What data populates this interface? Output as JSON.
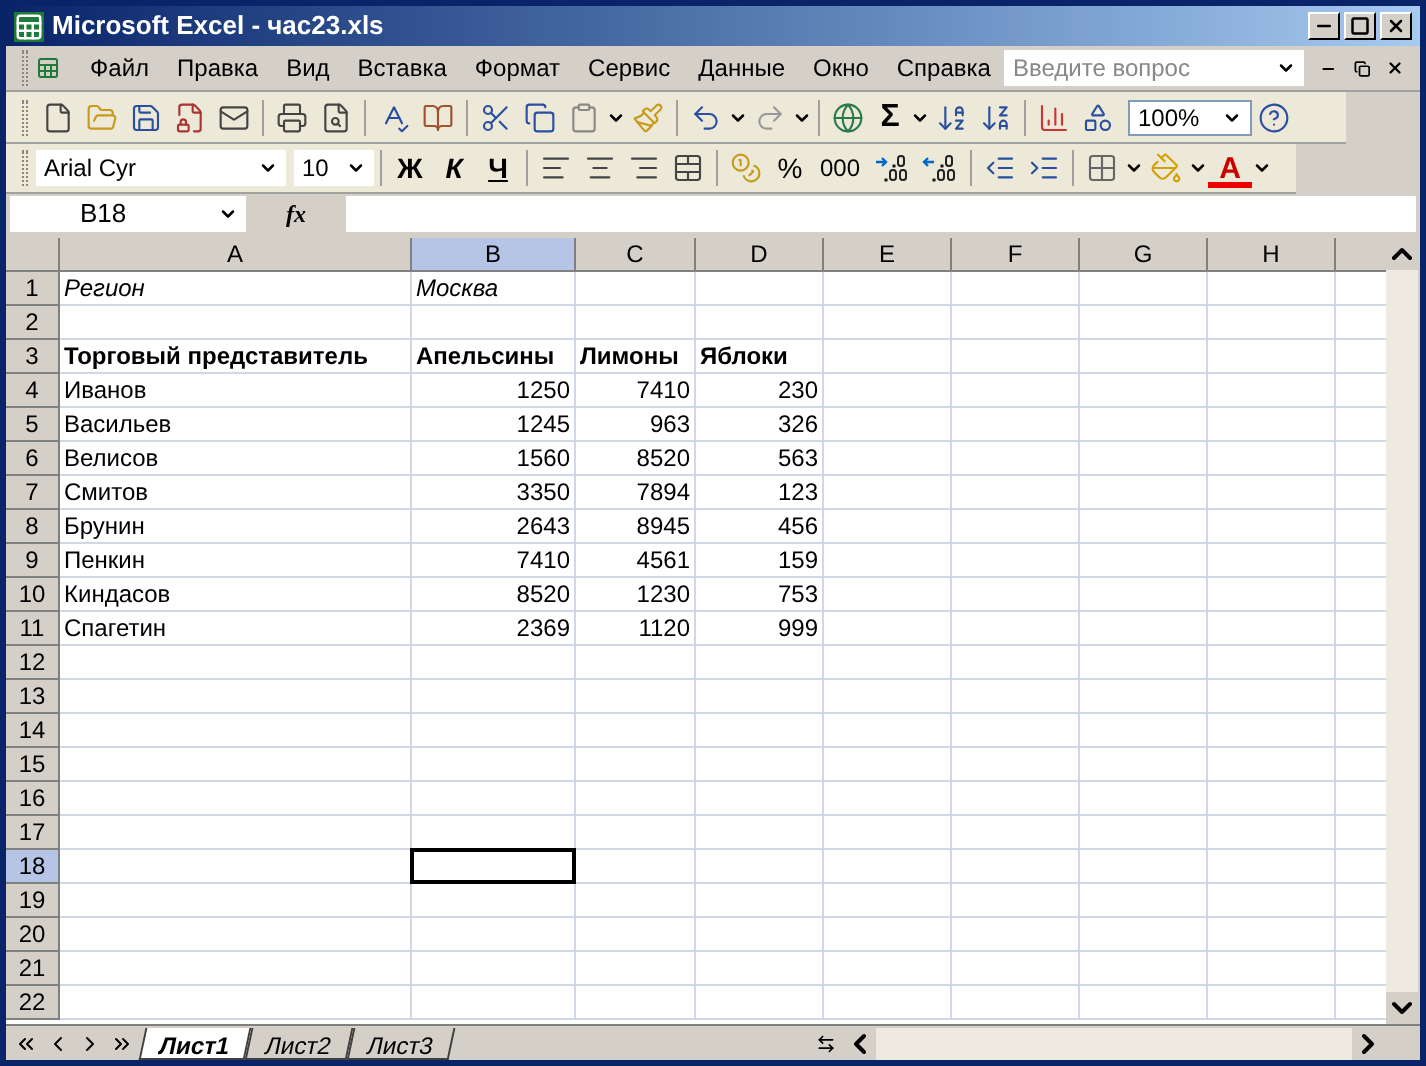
{
  "window": {
    "title": "Microsoft Excel - час23.xls"
  },
  "menu": [
    "Файл",
    "Правка",
    "Вид",
    "Вставка",
    "Формат",
    "Сервис",
    "Данные",
    "Окно",
    "Справка"
  ],
  "help_search": {
    "placeholder": "Введите вопрос"
  },
  "standard_toolbar": {
    "sum": "Σ",
    "zoom": "100%"
  },
  "format_toolbar": {
    "font": "Arial Cyr",
    "size": "10",
    "bold": "Ж",
    "italic": "К",
    "underline": "Ч",
    "percent": "%",
    "thousands": "000",
    "font_color": "A"
  },
  "formula_bar": {
    "name_box": "B18",
    "fx": "fx"
  },
  "columns": [
    {
      "label": "A",
      "selected": false
    },
    {
      "label": "B",
      "selected": true
    },
    {
      "label": "C",
      "selected": false
    },
    {
      "label": "D",
      "selected": false
    },
    {
      "label": "E",
      "selected": false
    },
    {
      "label": "F",
      "selected": false
    },
    {
      "label": "G",
      "selected": false
    },
    {
      "label": "H",
      "selected": false
    }
  ],
  "rows": [
    {
      "number": "1",
      "kind": "italic",
      "selected": false,
      "cells": [
        "Регион",
        "Москва"
      ]
    },
    {
      "number": "2",
      "kind": "empty",
      "selected": false,
      "cells": []
    },
    {
      "number": "3",
      "kind": "header",
      "selected": false,
      "cells": [
        "Торговый представитель",
        "Апельсины",
        "Лимоны",
        "Яблоки"
      ]
    },
    {
      "number": "4",
      "kind": "data",
      "selected": false,
      "cells": [
        "Иванов",
        "1250",
        "7410",
        "230"
      ]
    },
    {
      "number": "5",
      "kind": "data",
      "selected": false,
      "cells": [
        "Васильев",
        "1245",
        "963",
        "326"
      ]
    },
    {
      "number": "6",
      "kind": "data",
      "selected": false,
      "cells": [
        "Велисов",
        "1560",
        "8520",
        "563"
      ]
    },
    {
      "number": "7",
      "kind": "data",
      "selected": false,
      "cells": [
        "Смитов",
        "3350",
        "7894",
        "123"
      ]
    },
    {
      "number": "8",
      "kind": "data",
      "selected": false,
      "cells": [
        "Брунин",
        "2643",
        "8945",
        "456"
      ]
    },
    {
      "number": "9",
      "kind": "data",
      "selected": false,
      "cells": [
        "Пенкин",
        "7410",
        "4561",
        "159"
      ]
    },
    {
      "number": "10",
      "kind": "data",
      "selected": false,
      "cells": [
        "Киндасов",
        "8520",
        "1230",
        "753"
      ]
    },
    {
      "number": "11",
      "kind": "data",
      "selected": false,
      "cells": [
        "Спагетин",
        "2369",
        "1120",
        "999"
      ]
    },
    {
      "number": "12",
      "kind": "empty",
      "selected": false,
      "cells": []
    },
    {
      "number": "13",
      "kind": "empty",
      "selected": false,
      "cells": []
    },
    {
      "number": "14",
      "kind": "empty",
      "selected": false,
      "cells": []
    },
    {
      "number": "15",
      "kind": "empty",
      "selected": false,
      "cells": []
    },
    {
      "number": "16",
      "kind": "empty",
      "selected": false,
      "cells": []
    },
    {
      "number": "17",
      "kind": "empty",
      "selected": false,
      "cells": []
    },
    {
      "number": "18",
      "kind": "empty",
      "selected": true,
      "cells": []
    },
    {
      "number": "19",
      "kind": "empty",
      "selected": false,
      "cells": []
    },
    {
      "number": "20",
      "kind": "empty",
      "selected": false,
      "cells": []
    },
    {
      "number": "21",
      "kind": "empty",
      "selected": false,
      "cells": []
    },
    {
      "number": "22",
      "kind": "empty",
      "selected": false,
      "cells": []
    }
  ],
  "sheet_tabs": [
    {
      "label": "Лист1",
      "selected": true
    },
    {
      "label": "Лист2",
      "selected": false
    },
    {
      "label": "Лист3",
      "selected": false
    }
  ]
}
